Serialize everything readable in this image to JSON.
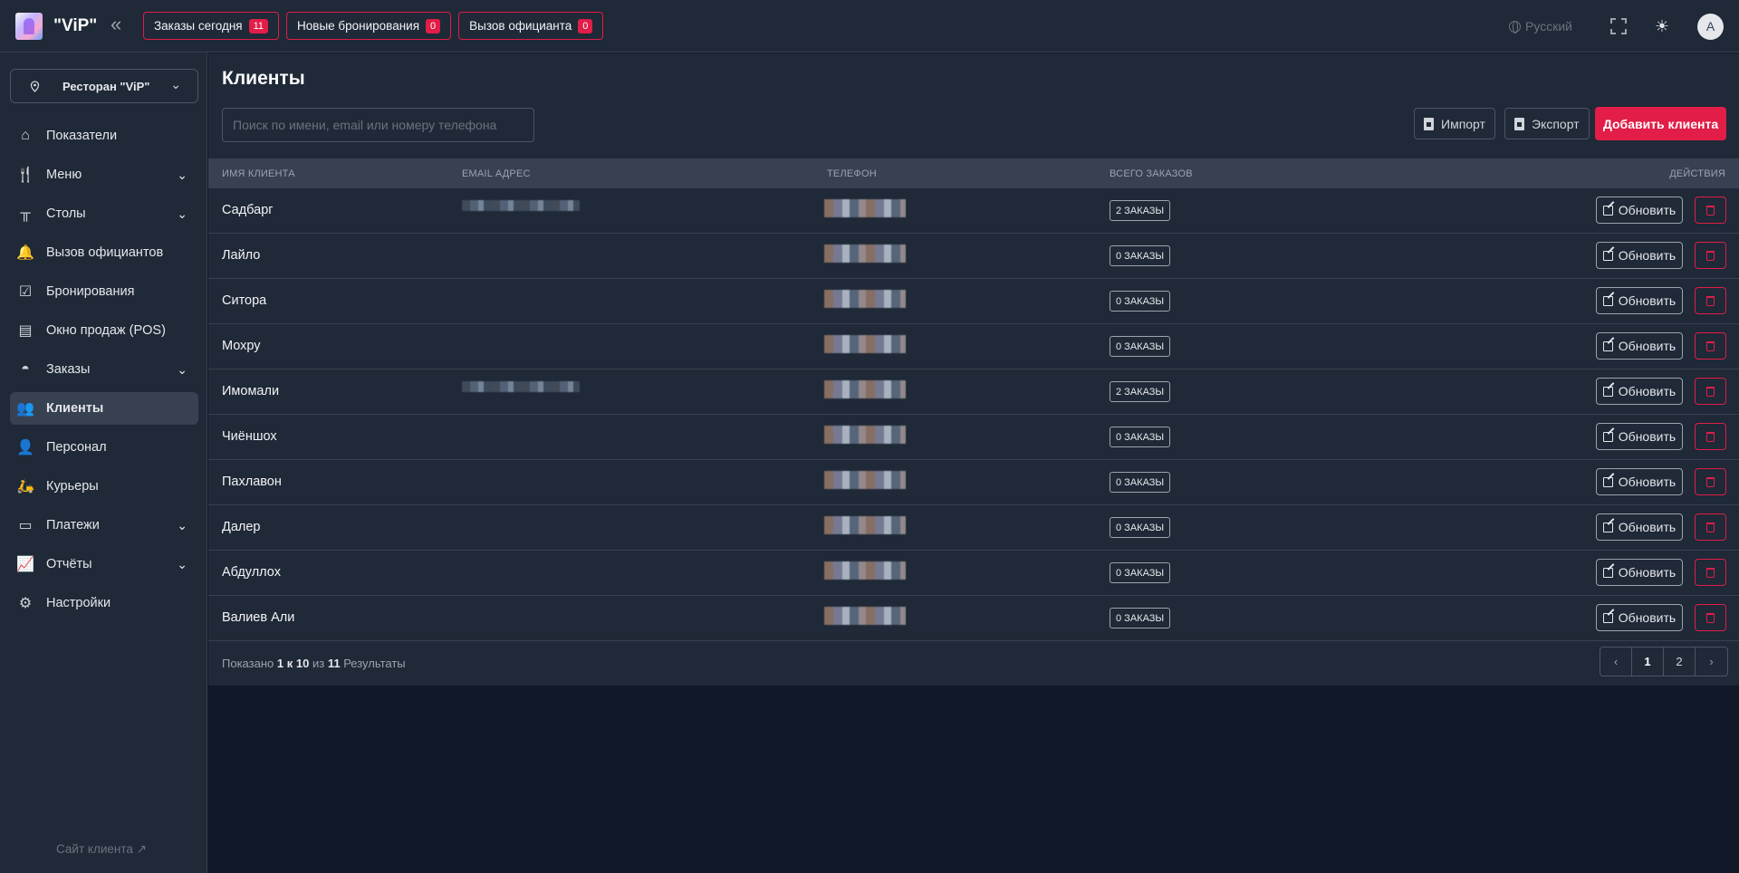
{
  "app": {
    "brand_name": "\"ViP\""
  },
  "header": {
    "badges": [
      {
        "label": "Заказы сегодня",
        "count": "11"
      },
      {
        "label": "Новые бронирования",
        "count": "0"
      },
      {
        "label": "Вызов официанта",
        "count": "0"
      }
    ],
    "language": "Русский",
    "avatar_letter": "A"
  },
  "sidebar": {
    "restaurant": "Ресторан \"ViP\"",
    "items": [
      {
        "label": "Показатели",
        "icon": "home-icon",
        "expandable": false
      },
      {
        "label": "Меню",
        "icon": "menu-icon",
        "expandable": true
      },
      {
        "label": "Столы",
        "icon": "table-icon",
        "expandable": true
      },
      {
        "label": "Вызов официантов",
        "icon": "bell-icon",
        "expandable": false
      },
      {
        "label": "Бронирования",
        "icon": "calendar-icon",
        "expandable": false
      },
      {
        "label": "Окно продаж (POS)",
        "icon": "pos-icon",
        "expandable": false
      },
      {
        "label": "Заказы",
        "icon": "cloche-icon",
        "expandable": true
      },
      {
        "label": "Клиенты",
        "icon": "users-icon",
        "expandable": false,
        "active": true
      },
      {
        "label": "Персонал",
        "icon": "staff-icon",
        "expandable": false
      },
      {
        "label": "Курьеры",
        "icon": "courier-icon",
        "expandable": false
      },
      {
        "label": "Платежи",
        "icon": "wallet-icon",
        "expandable": true
      },
      {
        "label": "Отчёты",
        "icon": "chart-icon",
        "expandable": true
      },
      {
        "label": "Настройки",
        "icon": "gear-icon",
        "expandable": false
      }
    ],
    "client_site": "Сайт клиента"
  },
  "main": {
    "title": "Клиенты",
    "search_placeholder": "Поиск по имени, email или номеру телефона",
    "import_label": "Импорт",
    "export_label": "Экспорт",
    "add_label": "Добавить клиента",
    "columns": [
      "ИМЯ КЛИЕНТА",
      "EMAIL АДРЕС",
      "ТЕЛЕФОН",
      "ВСЕГО ЗАКАЗОВ",
      "ДЕЙСТВИЯ"
    ],
    "rows": [
      {
        "name": "Садбарг",
        "orders": "2 ЗАКАЗЫ",
        "email_blurred": true
      },
      {
        "name": "Лайло",
        "orders": "0 ЗАКАЗЫ",
        "email_blurred": false
      },
      {
        "name": "Ситора",
        "orders": "0 ЗАКАЗЫ",
        "email_blurred": false
      },
      {
        "name": "Мохру",
        "orders": "0 ЗАКАЗЫ",
        "email_blurred": false
      },
      {
        "name": "Имомали",
        "orders": "2 ЗАКАЗЫ",
        "email_blurred": true
      },
      {
        "name": "Чиёншох",
        "orders": "0 ЗАКАЗЫ",
        "email_blurred": false
      },
      {
        "name": "Пахлавон",
        "orders": "0 ЗАКАЗЫ",
        "email_blurred": false
      },
      {
        "name": "Далер",
        "orders": "0 ЗАКАЗЫ",
        "email_blurred": false
      },
      {
        "name": "Абдуллох",
        "orders": "0 ЗАКАЗЫ",
        "email_blurred": false
      },
      {
        "name": "Валиев Али",
        "orders": "0 ЗАКАЗЫ",
        "email_blurred": false
      }
    ],
    "update_label": "Обновить",
    "footer": {
      "prefix": "Показано",
      "from": "1",
      "to_word": "к",
      "to": "10",
      "of_word": "из",
      "total": "11",
      "suffix": "Результаты"
    },
    "pages": [
      "1",
      "2"
    ]
  }
}
